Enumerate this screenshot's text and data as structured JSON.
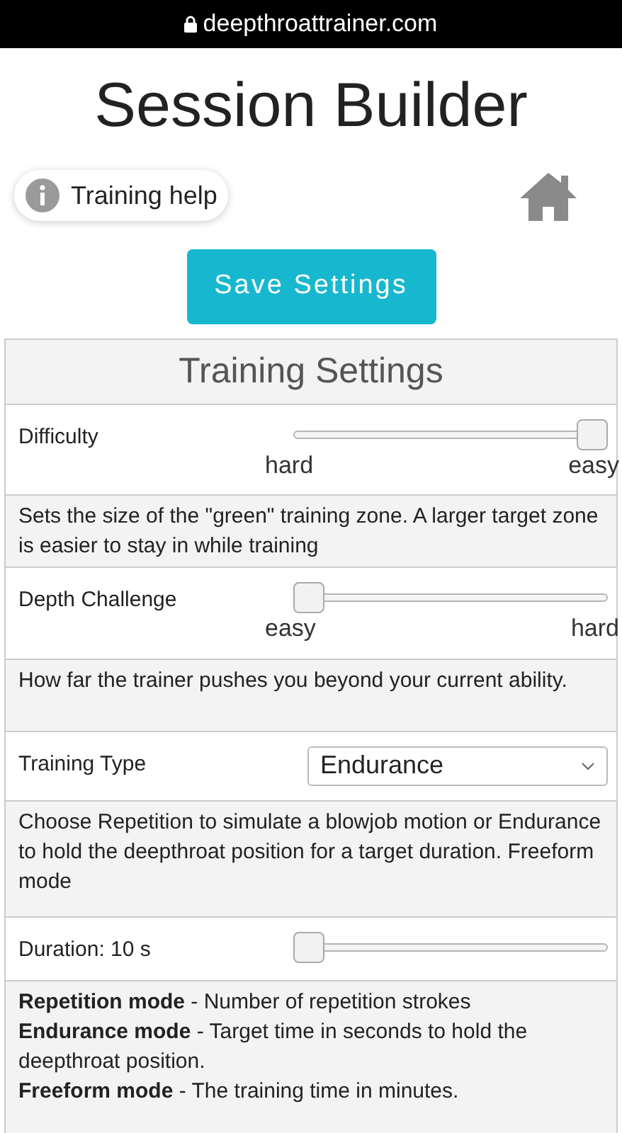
{
  "browser": {
    "url": "deepthroattrainer.com"
  },
  "title": "Session Builder",
  "help_button": {
    "label": "Training help"
  },
  "save_button": {
    "label": "Save Settings"
  },
  "panel": {
    "title": "Training Settings",
    "settings": [
      {
        "kind": "slider",
        "label": "Difficulty",
        "level": 1,
        "min_label": "hard",
        "max_label": "easy",
        "notes": [
          "Sets the size of the \"green\" training zone. A larger target zone is easier to stay in while training"
        ]
      },
      {
        "kind": "slider",
        "label": "Depth Challenge",
        "level": 0,
        "min_label": "easy",
        "max_label": "hard",
        "notes": [
          "How far the trainer pushes you beyond your current ability."
        ]
      },
      {
        "kind": "select",
        "label": "Training Type",
        "value": "Endurance",
        "notes": [
          "Choose Repetition to simulate a blowjob motion or Endurance to hold the deepthroat position for a target duration. Freeform mode"
        ]
      },
      {
        "kind": "slider",
        "label": "Duration: 10 s",
        "level": 0,
        "notes": [
          "**Repetition mode** - Number of repetition strokes",
          "**Endurance mode** - Target time in seconds to hold the deepthroat position.",
          "**Freeform mode** - The training time in minutes."
        ]
      }
    ]
  }
}
